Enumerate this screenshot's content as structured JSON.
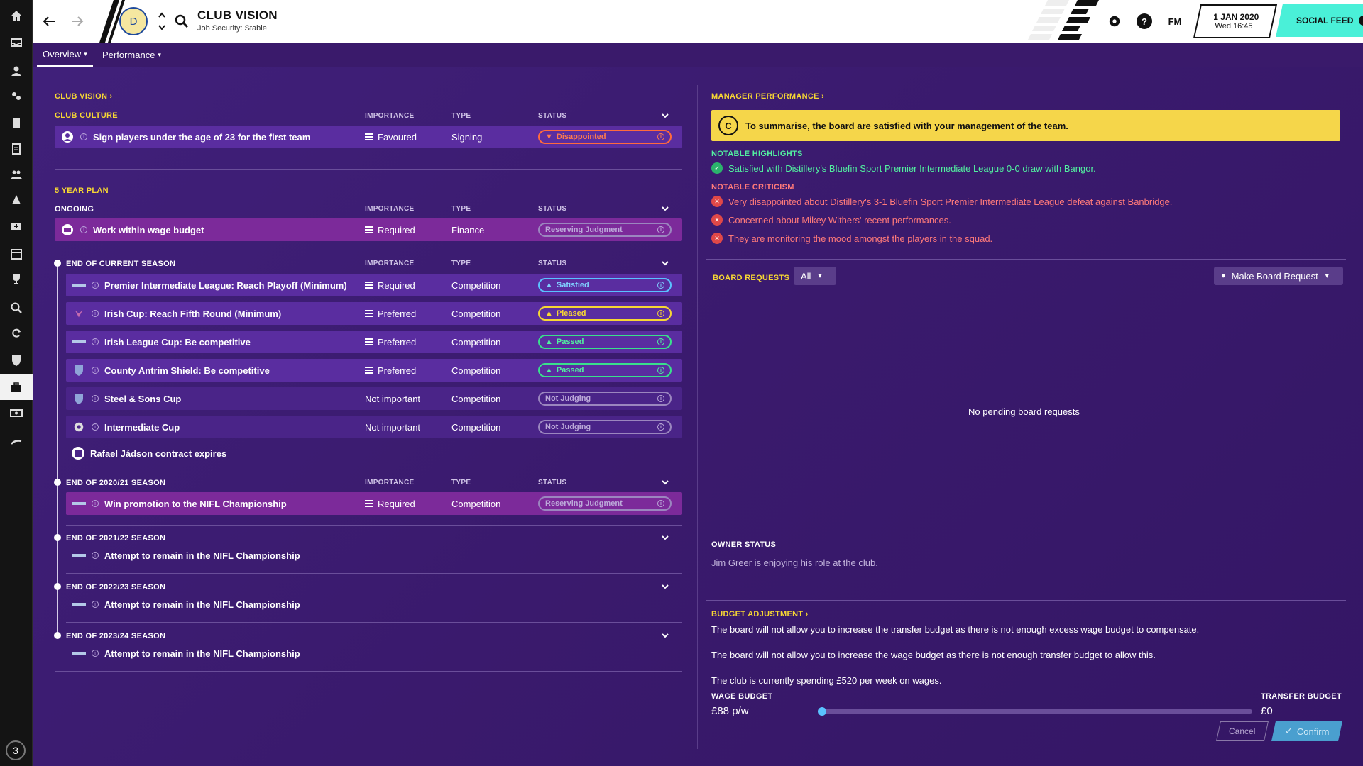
{
  "header": {
    "title": "CLUB VISION",
    "subtitle": "Job Security: Stable",
    "fm": "FM",
    "date": "1 JAN 2020",
    "time": "Wed 16:45",
    "social_feed": "SOCIAL FEED",
    "help": "?",
    "crest_letter": "D"
  },
  "sidebar": {
    "items": [
      "home-icon",
      "inbox-icon",
      "squad-icon",
      "dynamics-icon",
      "reports-icon",
      "notes-icon",
      "staff-icon",
      "training-icon",
      "medical-icon",
      "schedule-icon",
      "competitions-icon",
      "scouting-icon",
      "transfers-icon",
      "club-info-icon",
      "club-vision-icon",
      "finances-icon",
      "dev-centre-icon"
    ],
    "active_index": 14,
    "notification_count": "3"
  },
  "tabs": [
    {
      "label": "Overview"
    },
    {
      "label": "Performance"
    }
  ],
  "left": {
    "club_vision_link": "CLUB VISION",
    "culture_head": "CLUB CULTURE",
    "col_importance": "IMPORTANCE",
    "col_type": "TYPE",
    "col_status": "STATUS",
    "culture_row": {
      "text": "Sign players under the age of 23 for the first team",
      "importance": "Favoured",
      "type": "Signing",
      "status": "Disappointed"
    },
    "plan_head": "5 YEAR PLAN",
    "ongoing_head": "ONGOING",
    "ongoing_row": {
      "text": "Work within wage budget",
      "importance": "Required",
      "type": "Finance",
      "status": "Reserving Judgment"
    },
    "current_head": "END OF CURRENT SEASON",
    "current_rows": [
      {
        "text": "Premier Intermediate League: Reach Playoff (Minimum)",
        "importance": "Required",
        "type": "Competition",
        "status": "Satisfied"
      },
      {
        "text": "Irish Cup: Reach Fifth Round (Minimum)",
        "importance": "Preferred",
        "type": "Competition",
        "status": "Pleased"
      },
      {
        "text": "Irish League Cup: Be competitive",
        "importance": "Preferred",
        "type": "Competition",
        "status": "Passed"
      },
      {
        "text": "County Antrim Shield: Be competitive",
        "importance": "Preferred",
        "type": "Competition",
        "status": "Passed"
      },
      {
        "text": "Steel & Sons Cup",
        "importance": "Not important",
        "type": "Competition",
        "status": "Not Judging"
      },
      {
        "text": "Intermediate Cup",
        "importance": "Not important",
        "type": "Competition",
        "status": "Not Judging"
      }
    ],
    "contract_text": "Rafael Jádson contract expires",
    "s2021_head": "END OF 2020/21 SEASON",
    "s2021_row": {
      "text": "Win promotion to the NIFL Championship",
      "importance": "Required",
      "type": "Competition",
      "status": "Reserving Judgment"
    },
    "s2122_head": "END OF 2021/22 SEASON",
    "s2122_text": "Attempt to remain in the NIFL Championship",
    "s2223_head": "END OF 2022/23 SEASON",
    "s2223_text": "Attempt to remain in the NIFL Championship",
    "s2324_head": "END OF 2023/24 SEASON",
    "s2324_text": "Attempt to remain in the NIFL Championship"
  },
  "right": {
    "mp_link": "MANAGER PERFORMANCE",
    "grade": "C",
    "summary": "To summarise, the board are satisfied with your management of the team.",
    "highlights_head": "NOTABLE HIGHLIGHTS",
    "highlight": "Satisfied with Distillery's Bluefin Sport Premier Intermediate League 0-0 draw with Bangor.",
    "criticism_head": "NOTABLE CRITICISM",
    "criticisms": [
      "Very disappointed about Distillery's 3-1 Bluefin Sport Premier Intermediate League defeat against Banbridge.",
      "Concerned about Mikey Withers' recent performances.",
      "They are monitoring the mood amongst the players in the squad."
    ],
    "requests_head": "BOARD REQUESTS",
    "filter": "All",
    "make_request": "Make Board Request",
    "no_requests": "No pending board requests",
    "owner_head": "OWNER STATUS",
    "owner_text": "Jim Greer is enjoying his role at the club.",
    "budget_link": "BUDGET ADJUSTMENT",
    "budget_line1": "The board will not allow you to increase the transfer budget as there is not enough excess wage budget to compensate.",
    "budget_line2": "The board will not allow you to increase the wage budget as there is not enough transfer budget to allow this.",
    "budget_line3": "The club is currently spending £520 per week on wages.",
    "wage_label": "WAGE BUDGET",
    "wage_value": "£88 p/w",
    "transfer_label": "TRANSFER BUDGET",
    "transfer_value": "£0",
    "slider_fraction": 0,
    "cancel": "Cancel",
    "confirm": "Confirm"
  },
  "colors": {
    "accent_yellow": "#f7d733",
    "social": "#4af0d8",
    "bg": "#3c1a6e"
  }
}
